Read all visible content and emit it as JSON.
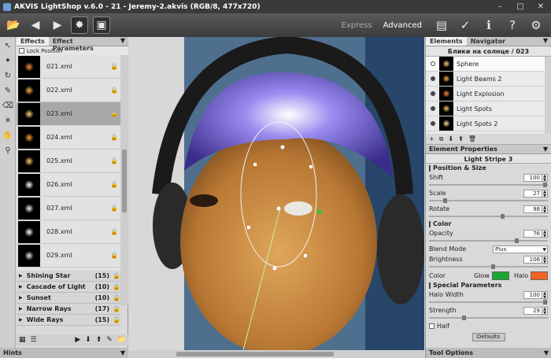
{
  "window": {
    "title": "AKVIS LightShop v.6.0 - 21 - Jeremy-2.akvis (RGB/8, 477x720)"
  },
  "toolbar": {
    "mode_express": "Express",
    "mode_advanced": "Advanced"
  },
  "left": {
    "tabs": [
      "Effects",
      "Effect Parameters"
    ],
    "lock_position": "Lock Position",
    "presets": [
      {
        "name": "021.xml",
        "color": "#ff8a3a"
      },
      {
        "name": "022.xml",
        "color": "#ffb14a"
      },
      {
        "name": "023.xml",
        "color": "#ffd27a"
      },
      {
        "name": "024.xml",
        "color": "#ff9c30"
      },
      {
        "name": "025.xml",
        "color": "#ffcc66"
      },
      {
        "name": "026.xml",
        "color": "#ffffff"
      },
      {
        "name": "027.xml",
        "color": "#e9f0ff"
      },
      {
        "name": "028.xml",
        "color": "#ffffff"
      },
      {
        "name": "029.xml",
        "color": "#dfeaff"
      }
    ],
    "selected_preset": "023.xml",
    "groups": [
      {
        "name": "Shining Star",
        "count": "(15)"
      },
      {
        "name": "Cascade of Light",
        "count": "(10)"
      },
      {
        "name": "Sunset",
        "count": "(10)"
      },
      {
        "name": "Narrow Rays",
        "count": "(17)"
      },
      {
        "name": "Wide Rays",
        "count": "(15)"
      }
    ],
    "hints_label": "Hints"
  },
  "right": {
    "tabs": [
      "Elements",
      "Navigator"
    ],
    "elements_header": "Блики на солнце / 023",
    "elements": [
      {
        "name": "Sphere",
        "color": "#ffd27a"
      },
      {
        "name": "Light Beams 2",
        "color": "#ffb14a"
      },
      {
        "name": "Light Explosion",
        "color": "#ff8a3a"
      },
      {
        "name": "Light Spots",
        "color": "#ffcc66"
      },
      {
        "name": "Light Spots 2",
        "color": "#ffe0a0"
      }
    ],
    "properties_label": "Element Properties",
    "element_name": "Light Stripe 3",
    "position_size": {
      "title": "Position & Size",
      "shift_label": "Shift",
      "shift": "100",
      "scale_label": "Scale",
      "scale": "27",
      "rotate_label": "Rotate",
      "rotate": "98"
    },
    "color": {
      "title": "Color",
      "opacity_label": "Opacity",
      "opacity": "76",
      "blend_label": "Blend Mode",
      "blend": "Plus",
      "brightness_label": "Brightness",
      "brightness": "106",
      "color_label": "Color",
      "glow_label": "Glow",
      "halo_label": "Halo",
      "glow_color": "#1aa834",
      "halo_color": "#f26522"
    },
    "special": {
      "title": "Special Parameters",
      "halo_width_label": "Halo Width",
      "halo_width": "100",
      "strength_label": "Strength",
      "strength": "29",
      "half_label": "Half"
    },
    "defaults_label": "Defaults",
    "tool_options_label": "Tool Options"
  }
}
